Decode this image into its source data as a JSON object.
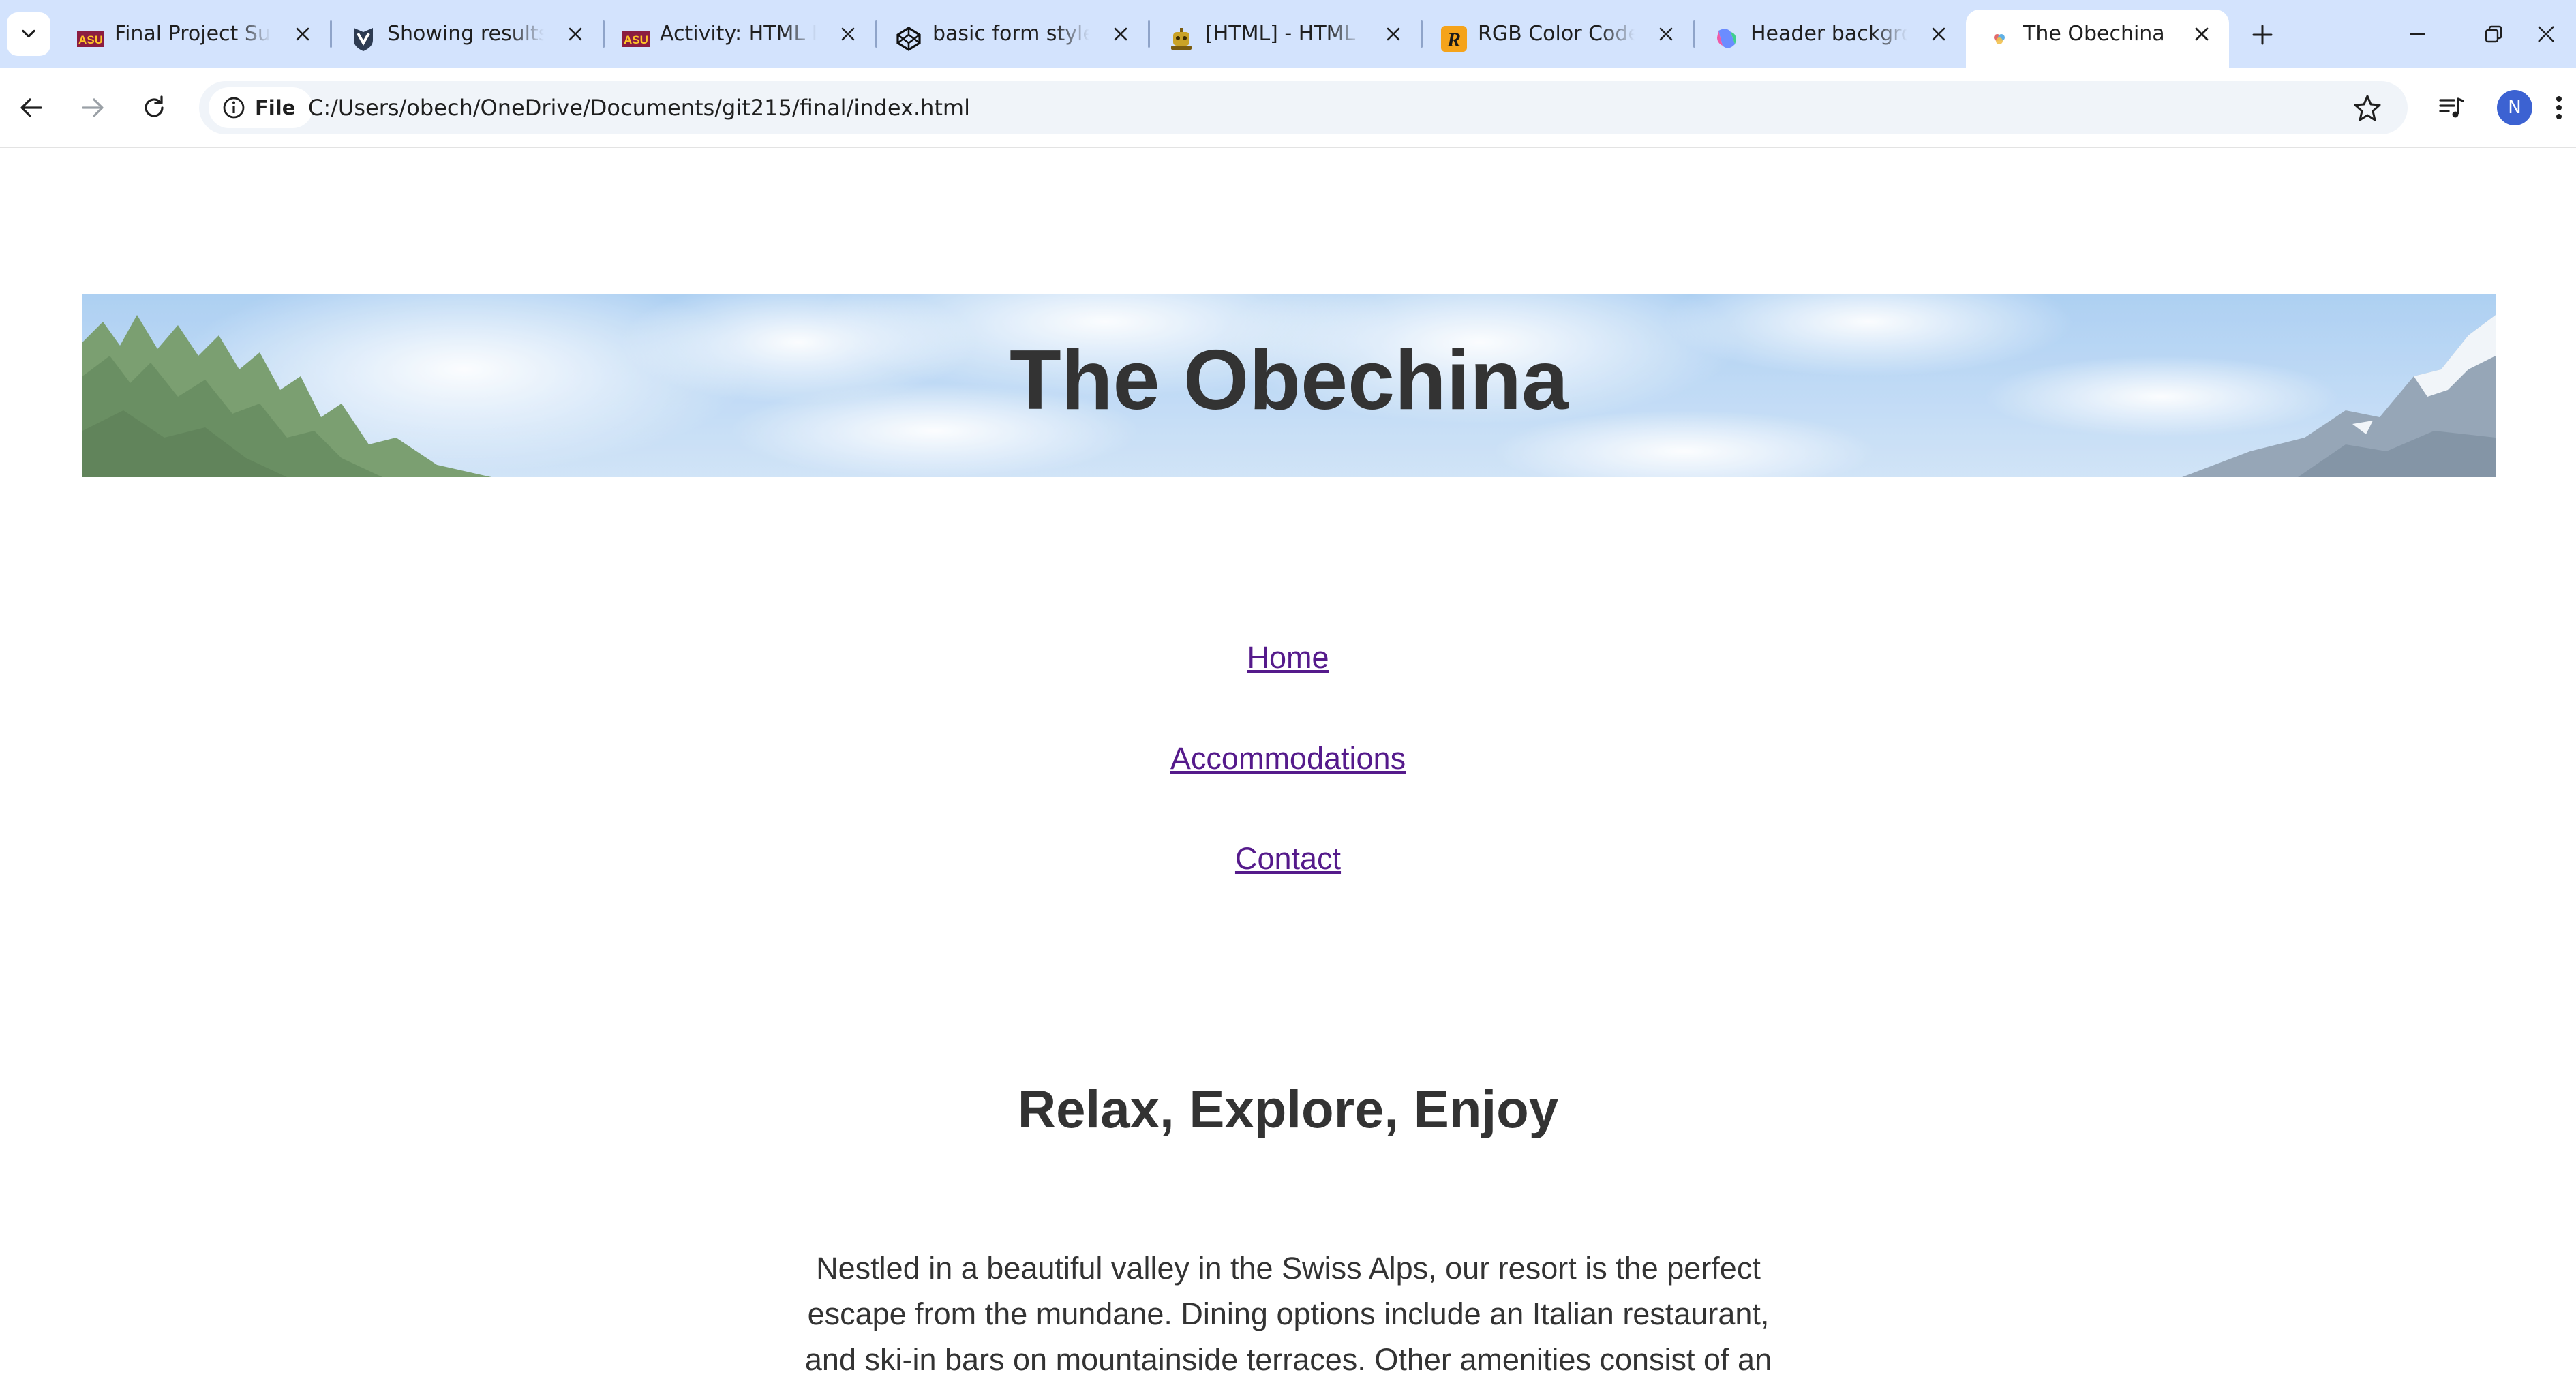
{
  "browser": {
    "tabs": [
      {
        "title": "Final Project Sub",
        "favicon": "asu-logo-icon",
        "active": false
      },
      {
        "title": "Showing results",
        "favicon": "shield-logo-icon",
        "active": false
      },
      {
        "title": "Activity: HTML In",
        "favicon": "asu-logo-icon",
        "active": false
      },
      {
        "title": "basic form styles",
        "favicon": "codepen-icon",
        "active": false
      },
      {
        "title": "[HTML] - HTML I",
        "favicon": "robot-icon",
        "active": false
      },
      {
        "title": "RGB Color Code",
        "favicon": "r-logo-icon",
        "active": false
      },
      {
        "title": "Header backgro",
        "favicon": "copilot-icon",
        "active": false
      },
      {
        "title": "The Obechina",
        "favicon": "page-favicon-icon",
        "active": true
      }
    ],
    "site_chip_label": "File",
    "url": "C:/Users/obech/OneDrive/Documents/git215/final/index.html",
    "profile_initial": "N",
    "colors": {
      "tabstrip": "#d3e3fd",
      "active_tab": "#ffffff",
      "omnibox": "#f0f4f9",
      "avatar": "#3c62d2"
    }
  },
  "page": {
    "title": "The Obechina",
    "nav": [
      {
        "label": "Home"
      },
      {
        "label": "Accommodations"
      },
      {
        "label": "Contact"
      }
    ],
    "tagline": "Relax, Explore, Enjoy",
    "intro": "Nestled in a beautiful valley in the Swiss Alps, our resort is the perfect escape from the mundane. Dining options include an Italian restaurant, and ski-in bars on mountainside terraces. Other amenities consist of an",
    "colors": {
      "text": "#333333",
      "link_visited": "#551a8b",
      "header_sky": "#a9cdf3"
    }
  }
}
